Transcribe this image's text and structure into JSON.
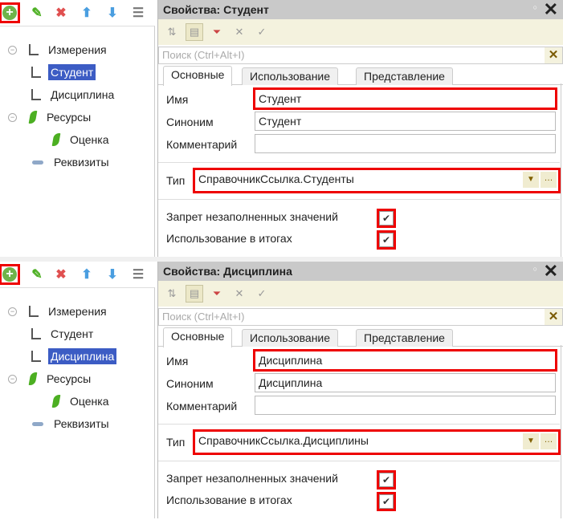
{
  "colors": {
    "highlight": "#e00000",
    "selection": "#3c5cc4",
    "title_bar": "#c9c9c9",
    "toolbar": "#f4f2de"
  },
  "left_toolbar_icons": [
    "add-icon",
    "edit-icon",
    "delete-icon",
    "move-up-icon",
    "move-down-icon",
    "sort-list-icon"
  ],
  "panels": [
    {
      "tree": {
        "dimensions": "Измерения",
        "dim_items": [
          "Студент",
          "Дисциплина"
        ],
        "resources": "Ресурсы",
        "res_items": [
          "Оценка"
        ],
        "attributes": "Реквизиты",
        "selected": 0
      },
      "title": "Свойства: Студент",
      "search_placeholder": "Поиск (Ctrl+Alt+I)",
      "tabs": [
        "Основные",
        "Использование",
        "Представление"
      ],
      "fields": {
        "name_label": "Имя",
        "name_value": "Студент",
        "synonym_label": "Синоним",
        "synonym_value": "Студент",
        "comment_label": "Комментарий",
        "comment_value": ""
      },
      "type_label": "Тип",
      "type_value": "СправочникСсылка.Студенты",
      "checks": [
        {
          "label": "Запрет незаполненных значений",
          "checked": true
        },
        {
          "label": "Использование в итогах",
          "checked": true
        }
      ]
    },
    {
      "tree": {
        "dimensions": "Измерения",
        "dim_items": [
          "Студент",
          "Дисциплина"
        ],
        "resources": "Ресурсы",
        "res_items": [
          "Оценка"
        ],
        "attributes": "Реквизиты",
        "selected": 1
      },
      "title": "Свойства: Дисциплина",
      "search_placeholder": "Поиск (Ctrl+Alt+I)",
      "tabs": [
        "Основные",
        "Использование",
        "Представление"
      ],
      "fields": {
        "name_label": "Имя",
        "name_value": "Дисциплина",
        "synonym_label": "Синоним",
        "synonym_value": "Дисциплина",
        "comment_label": "Комментарий",
        "comment_value": ""
      },
      "type_label": "Тип",
      "type_value": "СправочникСсылка.Дисциплины",
      "checks": [
        {
          "label": "Запрет незаполненных значений",
          "checked": true
        },
        {
          "label": "Использование в итогах",
          "checked": true
        }
      ]
    }
  ]
}
